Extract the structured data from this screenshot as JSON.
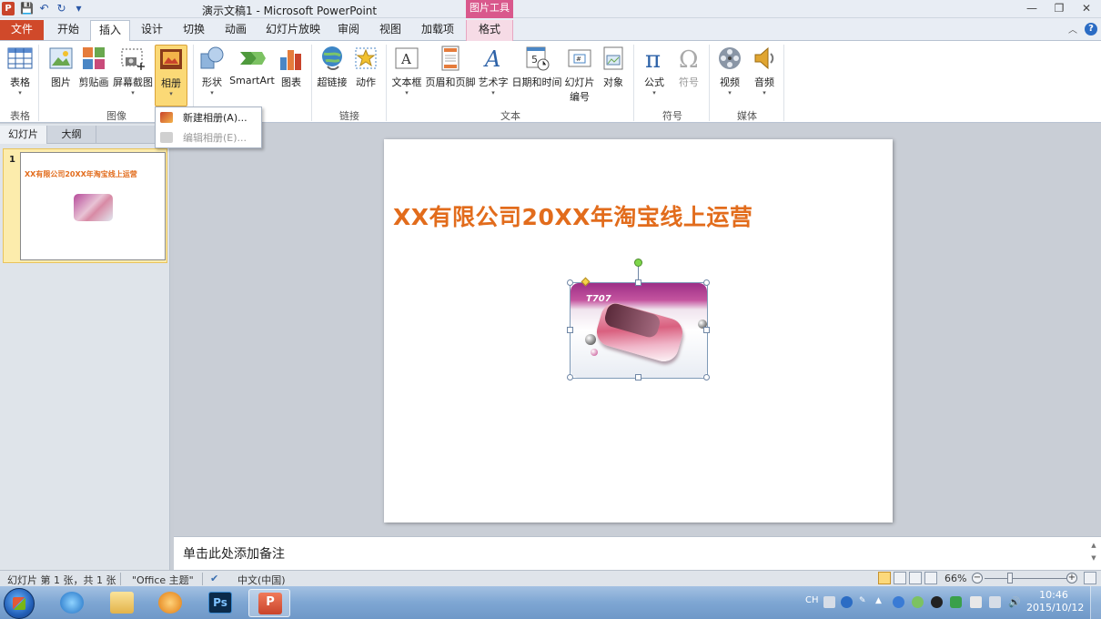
{
  "window": {
    "app_badge": "P",
    "title": "演示文稿1  -  Microsoft PowerPoint",
    "context_tools": "图片工具",
    "controls": [
      "—",
      "❐",
      "✕"
    ]
  },
  "tabs": {
    "file": "文件",
    "items": [
      "开始",
      "插入",
      "设计",
      "切换",
      "动画",
      "幻灯片放映",
      "审阅",
      "视图",
      "加载项"
    ],
    "context": "格式",
    "active": "插入"
  },
  "ribbon": {
    "table": {
      "label": "表格",
      "group": "表格"
    },
    "picture": "图片",
    "clipart": "剪贴画",
    "screenshot": "屏幕截图",
    "album": "相册",
    "images_group": "图像",
    "shapes": "形状",
    "smartart": "SmartArt",
    "chart": "图表",
    "hyperlink": "超链接",
    "action": "动作",
    "links_group": "链接",
    "textbox": "文本框",
    "header_footer": "页眉和页脚",
    "wordart": "艺术字",
    "datetime": "日期和时间",
    "slide_number": [
      "幻灯片",
      "编号"
    ],
    "object": "对象",
    "text_group": "文本",
    "equation": "公式",
    "symbol": "符号",
    "symbols_group": "符号",
    "video": "视频",
    "audio": "音频",
    "media_group": "媒体"
  },
  "album_menu": {
    "new_album": "新建相册(A)...",
    "edit_album": "编辑相册(E)..."
  },
  "left_panel": {
    "tab_slides": "幻灯片",
    "tab_outline": "大纲",
    "slide_number": "1",
    "thumb_title": "XX有限公司20XX年淘宝线上运营"
  },
  "slide": {
    "title": "XX有限公司20XX年淘宝线上运营",
    "picture_text": "T707"
  },
  "notes": {
    "placeholder": "单击此处添加备注"
  },
  "status": {
    "slide_info": "幻灯片 第 1 张，共 1 张",
    "theme": "\"Office 主题\"",
    "language": "中文(中国)",
    "zoom": "66%",
    "zoom_fraction": 0.66
  },
  "taskbar": {
    "ime": "CH",
    "time": "10:46",
    "date": "2015/10/12"
  },
  "colors": {
    "accent_file_tab": "#d0492a",
    "title_orange": "#e26c1c",
    "context_pink": "#d9588c",
    "highlight": "#fbd976"
  }
}
